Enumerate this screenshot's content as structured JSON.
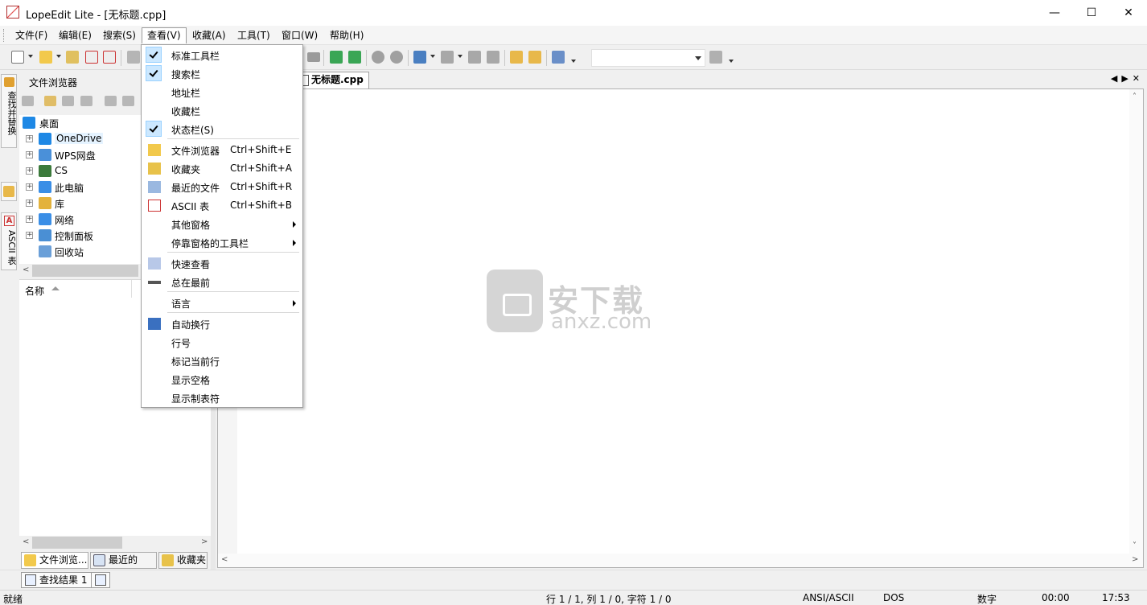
{
  "window": {
    "title": "LopeEdit Lite - [无标题.cpp]",
    "controls": {
      "minimize": "—",
      "maximize": "☐",
      "close": "✕"
    }
  },
  "menubar": {
    "items": [
      "文件(F)",
      "编辑(E)",
      "搜索(S)",
      "查看(V)",
      "收藏(A)",
      "工具(T)",
      "窗口(W)",
      "帮助(H)"
    ],
    "active_index": 3
  },
  "view_menu": {
    "items": [
      {
        "label": "标准工具栏",
        "checked": true
      },
      {
        "label": "搜索栏",
        "checked": true
      },
      {
        "label": "地址栏",
        "checked": false
      },
      {
        "label": "收藏栏",
        "checked": false
      },
      {
        "label": "状态栏(S)",
        "checked": true
      },
      {
        "label": "文件浏览器",
        "shortcut": "Ctrl+Shift+E",
        "icon": "folder-icon"
      },
      {
        "label": "收藏夹",
        "shortcut": "Ctrl+Shift+A",
        "icon": "star-icon"
      },
      {
        "label": "最近的文件",
        "shortcut": "Ctrl+Shift+R",
        "icon": "clock-icon"
      },
      {
        "label": "ASCII 表",
        "shortcut": "Ctrl+Shift+B",
        "icon": "ascii-icon"
      },
      {
        "label": "其他窗格",
        "submenu": true
      },
      {
        "label": "停靠窗格的工具栏",
        "submenu": true
      },
      {
        "label": "快速查看",
        "icon": "quickview-icon"
      },
      {
        "label": "总在最前",
        "icon": "pin-icon"
      },
      {
        "label": "语言",
        "submenu": true
      },
      {
        "label": "自动换行",
        "icon": "wrap-icon"
      },
      {
        "label": "行号"
      },
      {
        "label": "标记当前行"
      },
      {
        "label": "显示空格"
      },
      {
        "label": "显示制表符"
      }
    ]
  },
  "left_vtabs": {
    "find_replace": "查找并替换",
    "ascii": "ASCII 表"
  },
  "file_browser": {
    "title": "文件浏览器",
    "tree": [
      {
        "label": "桌面",
        "root": true,
        "icon": "desktop-icon",
        "color": "#1e88e5"
      },
      {
        "label": "OneDrive",
        "icon": "cloud-icon",
        "color": "#1e88e5",
        "highlight": true
      },
      {
        "label": "WPS网盘",
        "icon": "cloud-icon",
        "color": "#4a90d9"
      },
      {
        "label": "CS",
        "icon": "user-icon",
        "color": "#3b7a3b"
      },
      {
        "label": "此电脑",
        "icon": "computer-icon",
        "color": "#3a8ee6"
      },
      {
        "label": "库",
        "icon": "library-icon",
        "color": "#e3b23c"
      },
      {
        "label": "网络",
        "icon": "network-icon",
        "color": "#3a8ee6"
      },
      {
        "label": "控制面板",
        "icon": "control-panel-icon",
        "color": "#4a8fd4"
      },
      {
        "label": "回收站",
        "icon": "recycle-bin-icon",
        "color": "#6a9fd8",
        "no_expander": true
      }
    ],
    "list_header": "名称",
    "bottom_tabs": [
      "文件浏览...",
      "最近的文...",
      "收藏夹"
    ]
  },
  "editor": {
    "tab_label": "无标题.cpp",
    "tab_controls": "◀▶✕",
    "watermark_cn": "安下载",
    "watermark_en": "anxz.com"
  },
  "results": {
    "tab_label": "查找结果 1"
  },
  "status": {
    "ready": "就绪",
    "position": "行 1 / 1, 列 1 / 0, 字符 1 / 0",
    "encoding": "ANSI/ASCII",
    "line_ending": "DOS",
    "numlock": "数字",
    "elapsed": "00:00",
    "clock": "17:53"
  }
}
